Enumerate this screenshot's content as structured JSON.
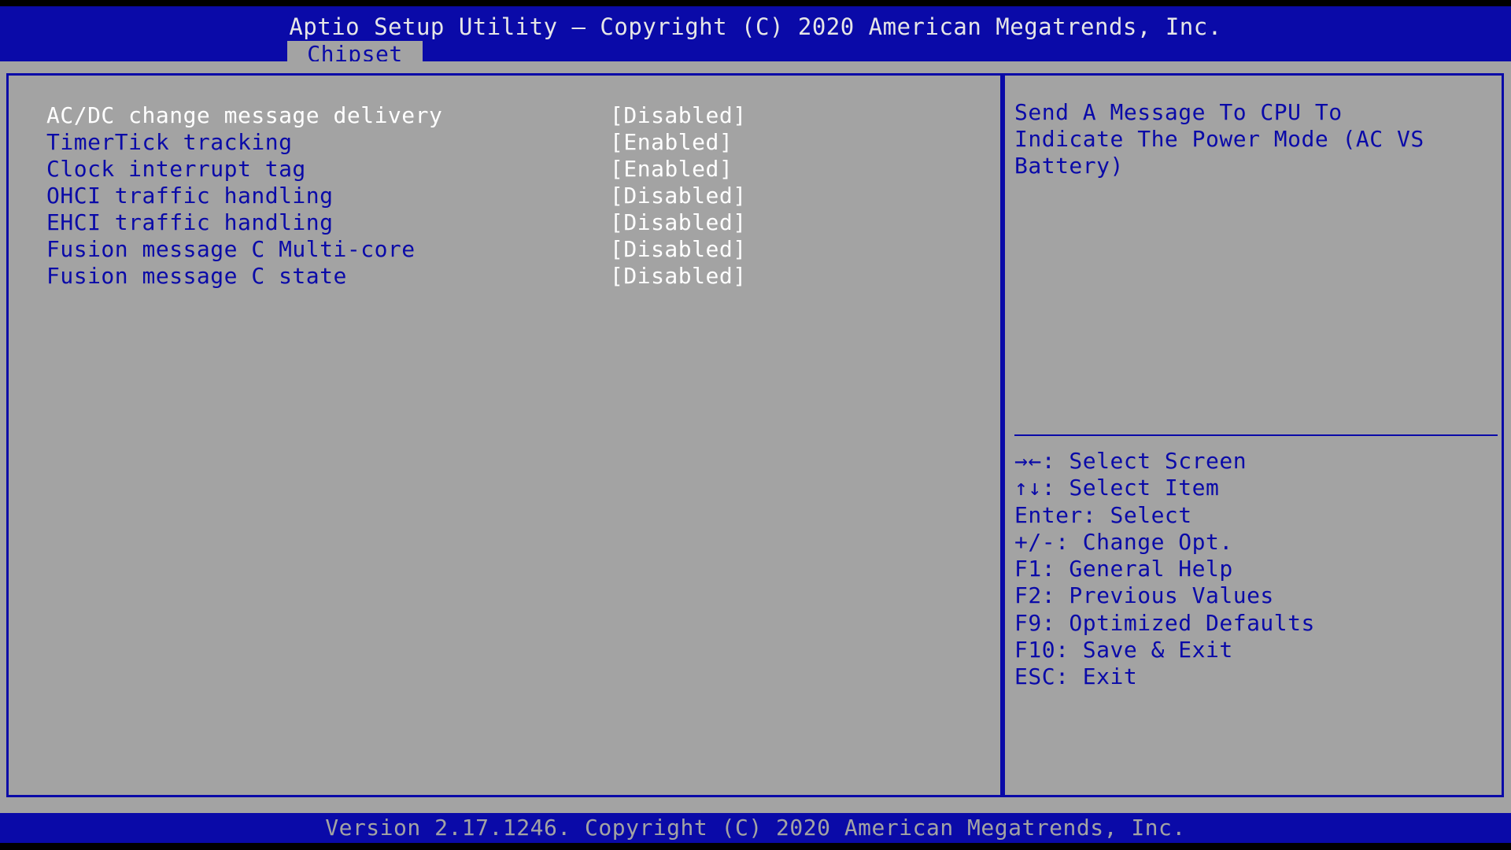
{
  "header": {
    "title": "Aptio Setup Utility – Copyright (C) 2020 American Megatrends, Inc.",
    "active_tab": "Chipset"
  },
  "settings": [
    {
      "label": "AC/DC change message delivery",
      "value": "[Disabled]",
      "selected": true
    },
    {
      "label": "TimerTick tracking",
      "value": "[Enabled]",
      "selected": false
    },
    {
      "label": "Clock interrupt tag",
      "value": "[Enabled]",
      "selected": false
    },
    {
      "label": "OHCI traffic handling",
      "value": "[Disabled]",
      "selected": false
    },
    {
      "label": "EHCI traffic handling",
      "value": "[Disabled]",
      "selected": false
    },
    {
      "label": "Fusion message C Multi-core",
      "value": "[Disabled]",
      "selected": false
    },
    {
      "label": "Fusion message C state",
      "value": "[Disabled]",
      "selected": false
    }
  ],
  "help": {
    "lines": [
      "Send A Message To CPU To",
      "Indicate The Power Mode (AC VS",
      "Battery)"
    ]
  },
  "keys": [
    "→←: Select Screen",
    "↑↓: Select Item",
    "Enter: Select",
    "+/-: Change Opt.",
    "F1: General Help",
    "F2: Previous Values",
    "F9: Optimized Defaults",
    "F10: Save & Exit",
    "ESC: Exit"
  ],
  "footer": {
    "version": "Version 2.17.1246. Copyright (C) 2020 American Megatrends, Inc."
  },
  "colors": {
    "bios_blue": "#0a0aa8",
    "panel_gray": "#a3a3a3",
    "highlight_white": "#ffffff"
  }
}
